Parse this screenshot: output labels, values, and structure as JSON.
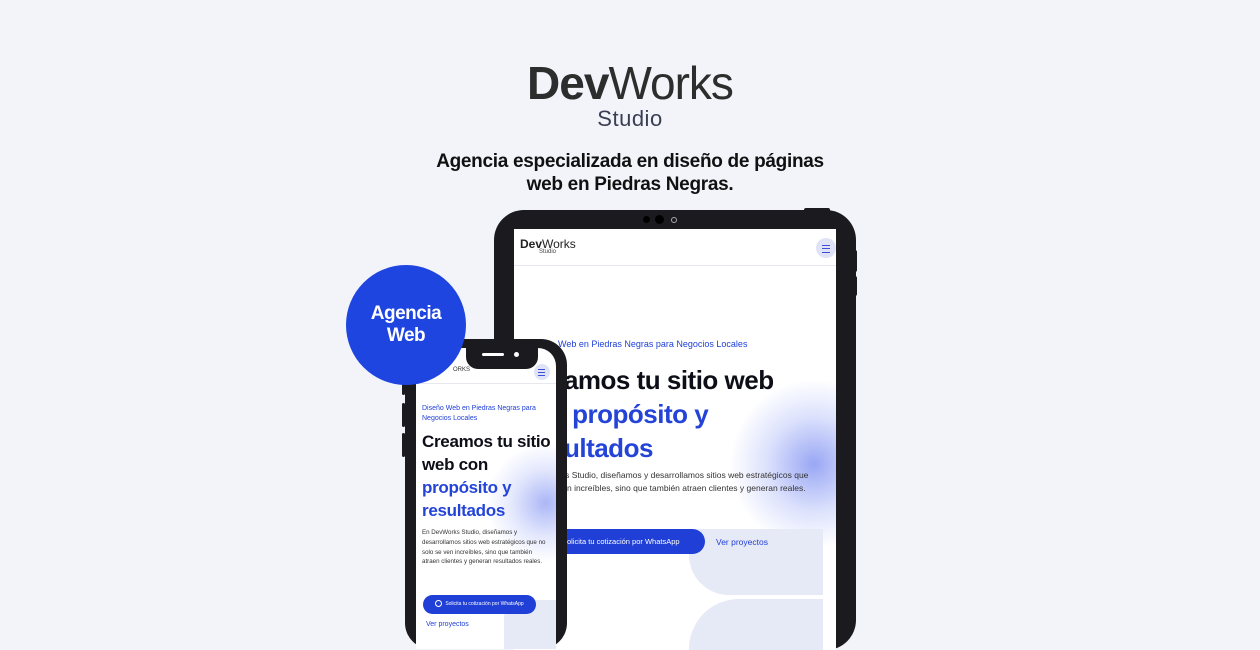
{
  "brand": {
    "main_bold": "Dev",
    "main_light": "Works",
    "sub": "Studio"
  },
  "tagline": {
    "line1": "Agencia especializada en diseño de páginas",
    "line2": "web en Piedras Negras."
  },
  "badge": {
    "line1": "Agencia",
    "line2": "Web"
  },
  "tablet": {
    "logo_bold": "Dev",
    "logo_light": "Works",
    "logo_sub": "Studio",
    "eyebrow": "Web en Piedras Negras para Negocios Locales",
    "headline_line1": "eamos tu sitio web",
    "headline_line2_dark": "n ",
    "headline_line2_blue": "propósito y",
    "headline_line3": "sultados",
    "paragraph": "rks Studio, diseñamos y desarrollamos sitios web estratégicos que ven increíbles, sino que también atraen clientes y generan reales.",
    "cta": "Solicita tu cotización por WhatsApp",
    "link": "Ver proyectos"
  },
  "phone": {
    "header_text": "ORKS",
    "eyebrow": "Diseño Web en Piedras Negras para Negocios Locales",
    "headline_dark": "Creamos tu sitio web con",
    "headline_blue": "propósito y resultados",
    "paragraph": "En DevWorks Studio, diseñamos y desarrollamos sitios web estratégicos que no solo se ven increíbles, sino que también atraen clientes y generan resultados reales.",
    "cta": "Solicita tu cotización por WhatsApp",
    "link": "Ver proyectos"
  },
  "colors": {
    "accent": "#1f3fd6",
    "badge": "#1f45e0",
    "background": "#f2f4fa",
    "device": "#1b1b1f"
  }
}
